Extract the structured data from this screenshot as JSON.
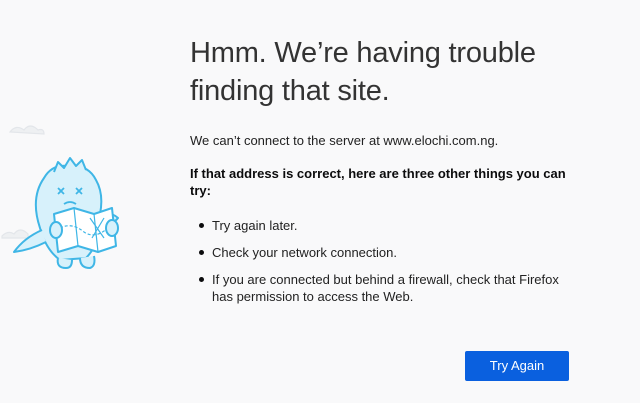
{
  "error": {
    "title_line1": "Hmm. We’re having trouble",
    "title_line2": "finding that site.",
    "description": "We can’t connect to the server at www.elochi.com.ng.",
    "advice_heading": "If that address is correct, here are three other things you can try:",
    "tips": [
      "Try again later.",
      "Check your network connection.",
      "If you are connected but behind a firewall, check that Firefox has permission to access the Web."
    ],
    "try_again_label": "Try Again"
  },
  "colors": {
    "background": "#f9f9fa",
    "button": "#0a60df",
    "illustration_stroke": "#3fb6e6",
    "illustration_fill": "#d7f1fb"
  },
  "icons": {
    "illustration": "confused-dinosaur-with-map-illustration"
  }
}
